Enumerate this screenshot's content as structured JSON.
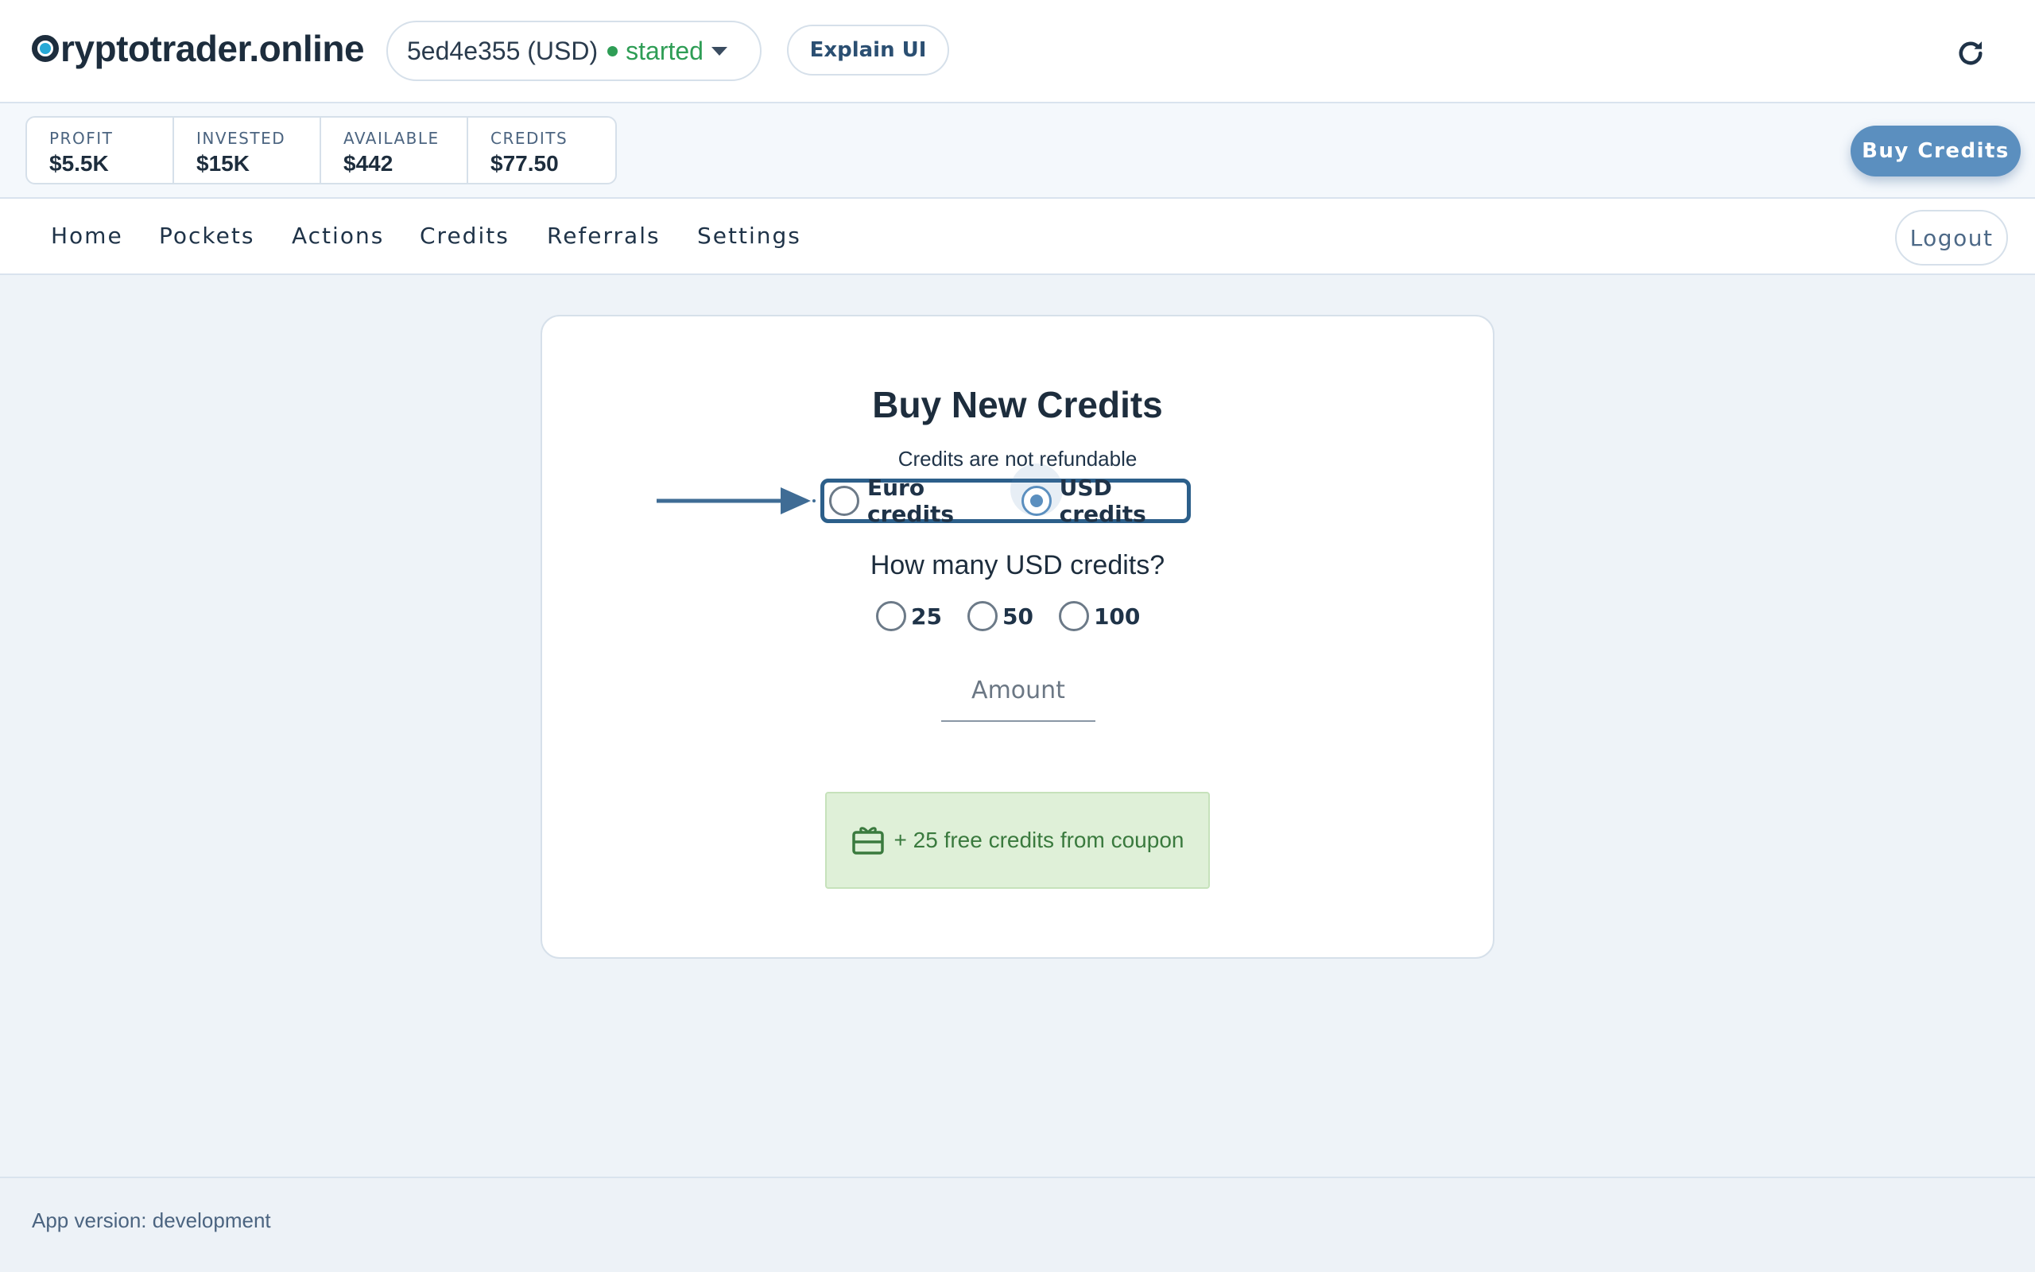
{
  "header": {
    "brand": "ryptotrader.online",
    "pocket": {
      "id": "5ed4e355 (USD)",
      "status": "started"
    },
    "explain_label": "Explain UI"
  },
  "stats": {
    "profit": {
      "label": "PROFIT",
      "value": "$5.5K"
    },
    "invested": {
      "label": "INVESTED",
      "value": "$15K"
    },
    "available": {
      "label": "AVAILABLE",
      "value": "$442"
    },
    "credits": {
      "label": "CREDITS",
      "value": "$77.50"
    },
    "buy_credits_label": "Buy Credits"
  },
  "nav": {
    "items": [
      "Home",
      "Pockets",
      "Actions",
      "Credits",
      "Referrals",
      "Settings"
    ],
    "logout_label": "Logout"
  },
  "main": {
    "title": "Buy New Credits",
    "subtitle": "Credits are not refundable",
    "currency_options": [
      {
        "label": "Euro credits",
        "checked": false
      },
      {
        "label": "USD credits",
        "checked": true
      }
    ],
    "question": "How many USD credits?",
    "amount_options": [
      "25",
      "50",
      "100"
    ],
    "amount_placeholder": "Amount",
    "coupon_text": "+ 25 free credits from coupon"
  },
  "footer": {
    "version_text": "App version: development"
  },
  "colors": {
    "accent": "#5b8fbf",
    "status_green": "#2e9d55",
    "coupon_bg": "#dff0d8",
    "highlight_border": "#2c5f8a"
  }
}
